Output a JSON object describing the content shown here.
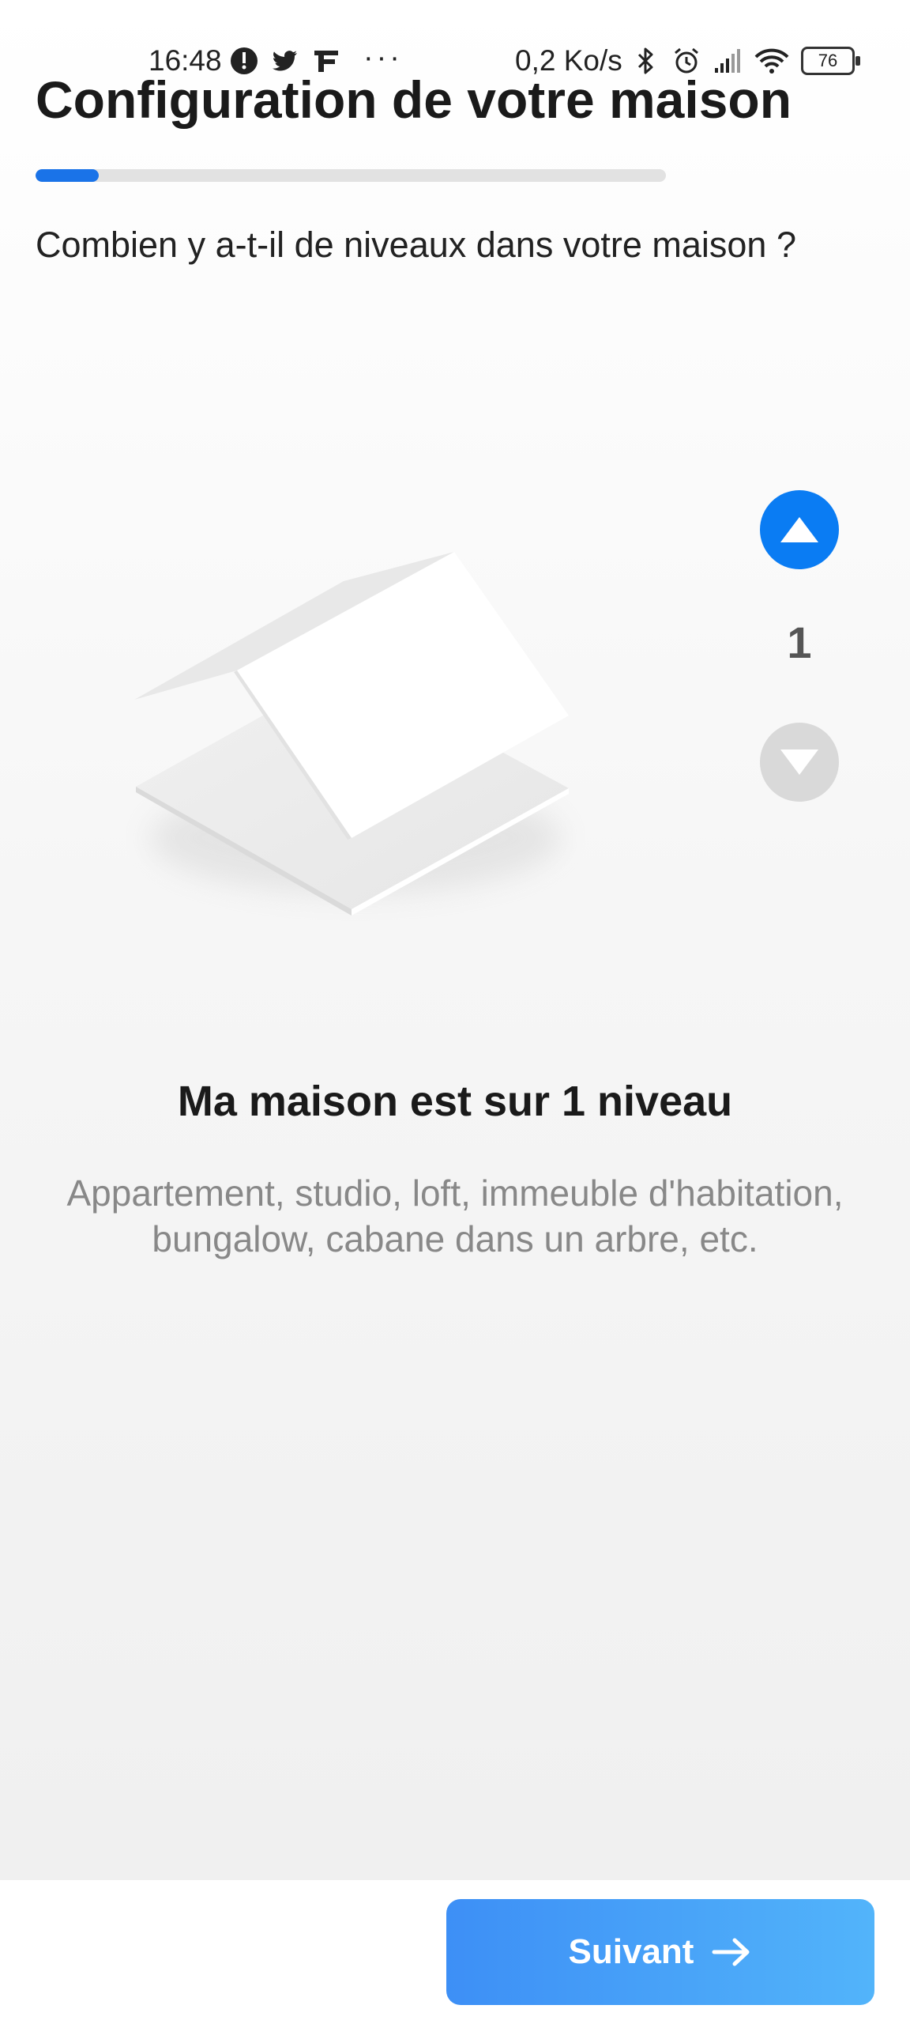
{
  "status_bar": {
    "time": "16:48",
    "dots": "···",
    "network_speed": "0,2 Ko/s",
    "battery_level": "76",
    "icons_left": [
      "notification-icon",
      "twitter-icon",
      "app-f-icon"
    ],
    "icons_right": [
      "bluetooth-icon",
      "alarm-icon",
      "signal-icon",
      "wifi-icon",
      "battery-icon"
    ]
  },
  "header": {
    "title": "Configuration de votre maison",
    "progress_fraction": 0.1
  },
  "question": "Combien y a-t-il de niveaux dans votre maison ?",
  "stepper": {
    "value": "1",
    "up_icon": "triangle-up-icon",
    "down_icon": "triangle-down-icon"
  },
  "level": {
    "title": "Ma maison est sur 1 niveau",
    "description": "Appartement, studio, loft, immeuble d'habitation, bungalow, cabane dans un arbre, etc."
  },
  "footer": {
    "next_label": "Suivant",
    "next_icon": "arrow-right-icon"
  },
  "colors": {
    "accent": "#0a7cf3",
    "progress": "#1a73e8",
    "button_gradient_start": "#3d8ff6",
    "button_gradient_end": "#52b4fa",
    "disabled": "#d9d9d9"
  }
}
